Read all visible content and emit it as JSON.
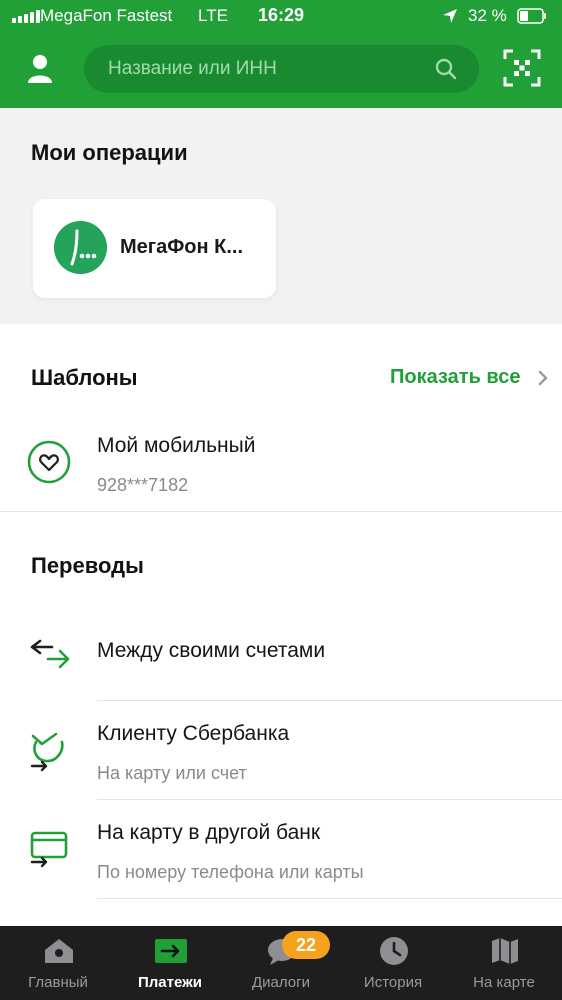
{
  "status_bar": {
    "carrier": "MegaFon Fastest",
    "network": "LTE",
    "time": "16:29",
    "battery": "32 %"
  },
  "header": {
    "search_placeholder": "Название или ИНН",
    "icons": [
      "user-icon",
      "search-icon",
      "qr-scan-icon"
    ]
  },
  "operations": {
    "title": "Мои операции",
    "items": [
      {
        "label": "МегаФон К..."
      }
    ]
  },
  "templates": {
    "title": "Шаблоны",
    "show_all": "Показать все",
    "items": [
      {
        "title": "Мой мобильный",
        "subtitle": "928***7182",
        "icon": "heart-icon"
      }
    ]
  },
  "transfers": {
    "title": "Переводы",
    "items": [
      {
        "title": "Между своими счетами",
        "subtitle": "",
        "icon": "swap-arrows-icon"
      },
      {
        "title": "Клиенту Сбербанка",
        "subtitle": "На карту или счет",
        "icon": "sberbank-transfer-icon"
      },
      {
        "title": "На карту в другой банк",
        "subtitle": "По номеру телефона или карты",
        "icon": "card-transfer-icon"
      }
    ]
  },
  "tabbar": {
    "tabs": [
      {
        "label": "Главный",
        "icon": "home-icon"
      },
      {
        "label": "Платежи",
        "icon": "payments-icon",
        "active": true
      },
      {
        "label": "Диалоги",
        "icon": "chat-icon",
        "badge": "22"
      },
      {
        "label": "История",
        "icon": "clock-icon"
      },
      {
        "label": "На карте",
        "icon": "map-icon"
      }
    ]
  },
  "colors": {
    "brand_green": "#21a038",
    "search_bg": "#1a8a30",
    "tabbar_bg": "#1e1e1e",
    "badge": "#f7a21c",
    "megafon_logo": "#25a35a"
  }
}
